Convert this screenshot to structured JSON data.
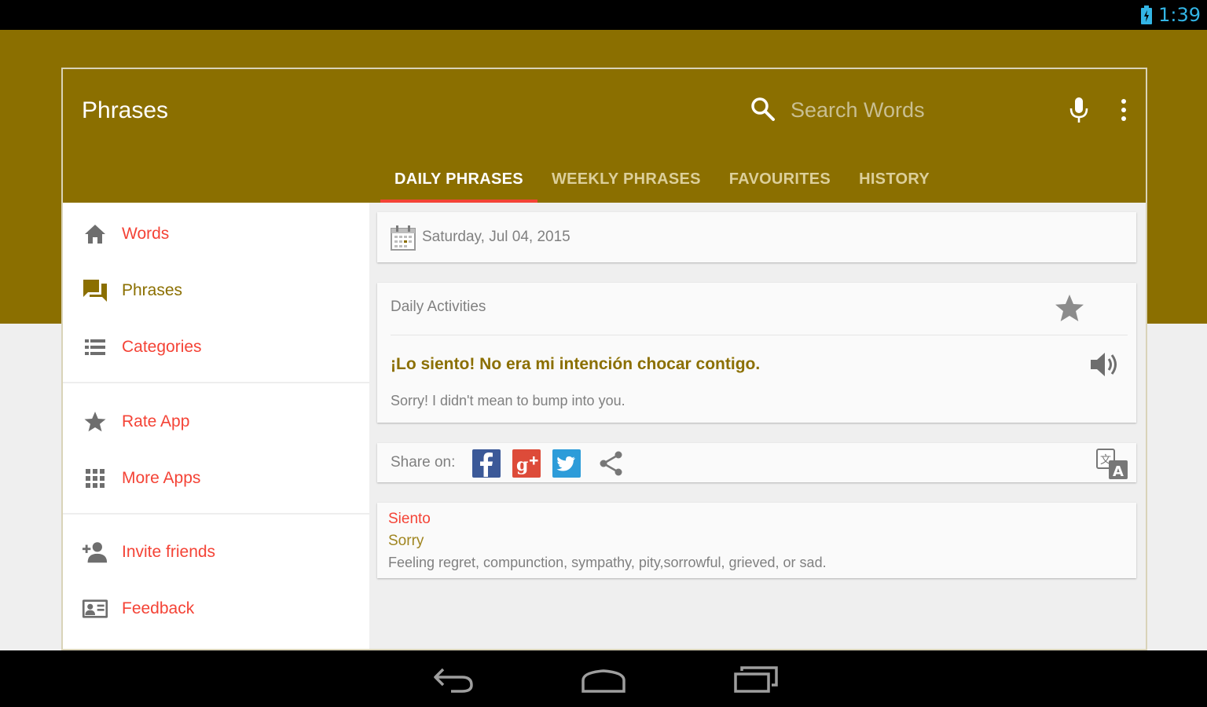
{
  "status_bar": {
    "time": "1:39"
  },
  "toolbar": {
    "title": "Phrases",
    "search_placeholder": "Search Words"
  },
  "tabs": [
    {
      "label": "DAILY PHRASES",
      "active": true
    },
    {
      "label": "WEEKLY PHRASES",
      "active": false
    },
    {
      "label": "FAVOURITES",
      "active": false
    },
    {
      "label": "HISTORY",
      "active": false
    }
  ],
  "drawer": {
    "items": [
      {
        "label": "Words",
        "icon": "home-icon"
      },
      {
        "label": "Phrases",
        "icon": "chat-icon",
        "selected": true
      },
      {
        "label": "Categories",
        "icon": "list-icon"
      },
      {
        "label": "Rate App",
        "icon": "star-icon"
      },
      {
        "label": "More Apps",
        "icon": "apps-grid-icon"
      },
      {
        "label": "Invite friends",
        "icon": "person-add-icon"
      },
      {
        "label": "Feedback",
        "icon": "contact-card-icon"
      }
    ]
  },
  "date_card": {
    "date": "Saturday, Jul 04, 2015"
  },
  "phrase_card": {
    "category": "Daily Activities",
    "spanish": "¡Lo siento! No era mi intención chocar contigo.",
    "english": "Sorry! I didn't mean to bump into you."
  },
  "share_card": {
    "label": "Share on:"
  },
  "dictionary_card": {
    "word": "Siento",
    "translation": "Sorry",
    "definition": "Feeling regret, compunction, sympathy, pity,sorrowful, grieved, or sad."
  },
  "colors": {
    "primary": "#8b6f00",
    "accent": "#f44336",
    "status_clock": "#33b5e5"
  }
}
